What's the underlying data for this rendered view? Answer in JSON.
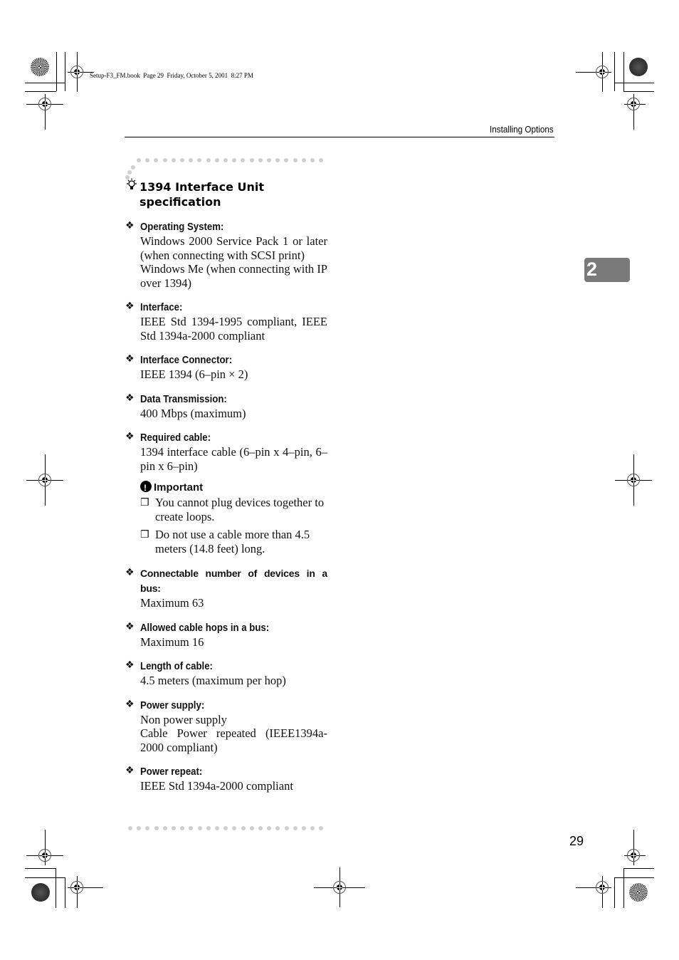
{
  "slug_line": "Setup-F3_FM.book  Page 29  Friday, October 5, 2001  8:27 PM",
  "running_head": "Installing Options",
  "chapter_tab": "2",
  "page_number": "29",
  "tip": {
    "icon": "lightbulb-icon",
    "title_line1": "1394 Interface Unit",
    "title_line2": "specification"
  },
  "specs": [
    {
      "label": "Operating System:",
      "values": [
        "Windows 2000 Service Pack 1 or later (when connecting with SCSI print)",
        "Windows Me (when connecting with IP over 1394)"
      ]
    },
    {
      "label": "Interface:",
      "values": [
        "IEEE Std 1394-1995 compliant, IEEE Std 1394a-2000 compliant"
      ]
    },
    {
      "label": "Interface Connector:",
      "values": [
        "IEEE 1394 (6–pin × 2)"
      ]
    },
    {
      "label": "Data Transmission:",
      "values": [
        "400 Mbps (maximum)"
      ]
    },
    {
      "label": "Required cable:",
      "values": [
        "1394 interface cable (6–pin x 4–pin, 6–pin x 6–pin)"
      ]
    },
    {
      "label": "Connectable number of devices in a bus:",
      "values": [
        "Maximum 63"
      ]
    },
    {
      "label": "Allowed cable hops in a bus:",
      "values": [
        "Maximum 16"
      ]
    },
    {
      "label": "Length of cable:",
      "values": [
        "4.5 meters (maximum per hop)"
      ]
    },
    {
      "label": "Power supply:",
      "values": [
        "Non power supply",
        "Cable Power repeated (IEEE1394a-2000 compliant)"
      ]
    },
    {
      "label": "Power repeat:",
      "values": [
        "IEEE Std 1394a-2000 compliant"
      ]
    }
  ],
  "important": {
    "title": "Important",
    "notes": [
      "You cannot plug devices together to create loops.",
      "Do not use a cable more than 4.5 meters (14.8 feet) long."
    ]
  },
  "glyphs": {
    "bullet": "❖",
    "checkbox": "❒"
  }
}
